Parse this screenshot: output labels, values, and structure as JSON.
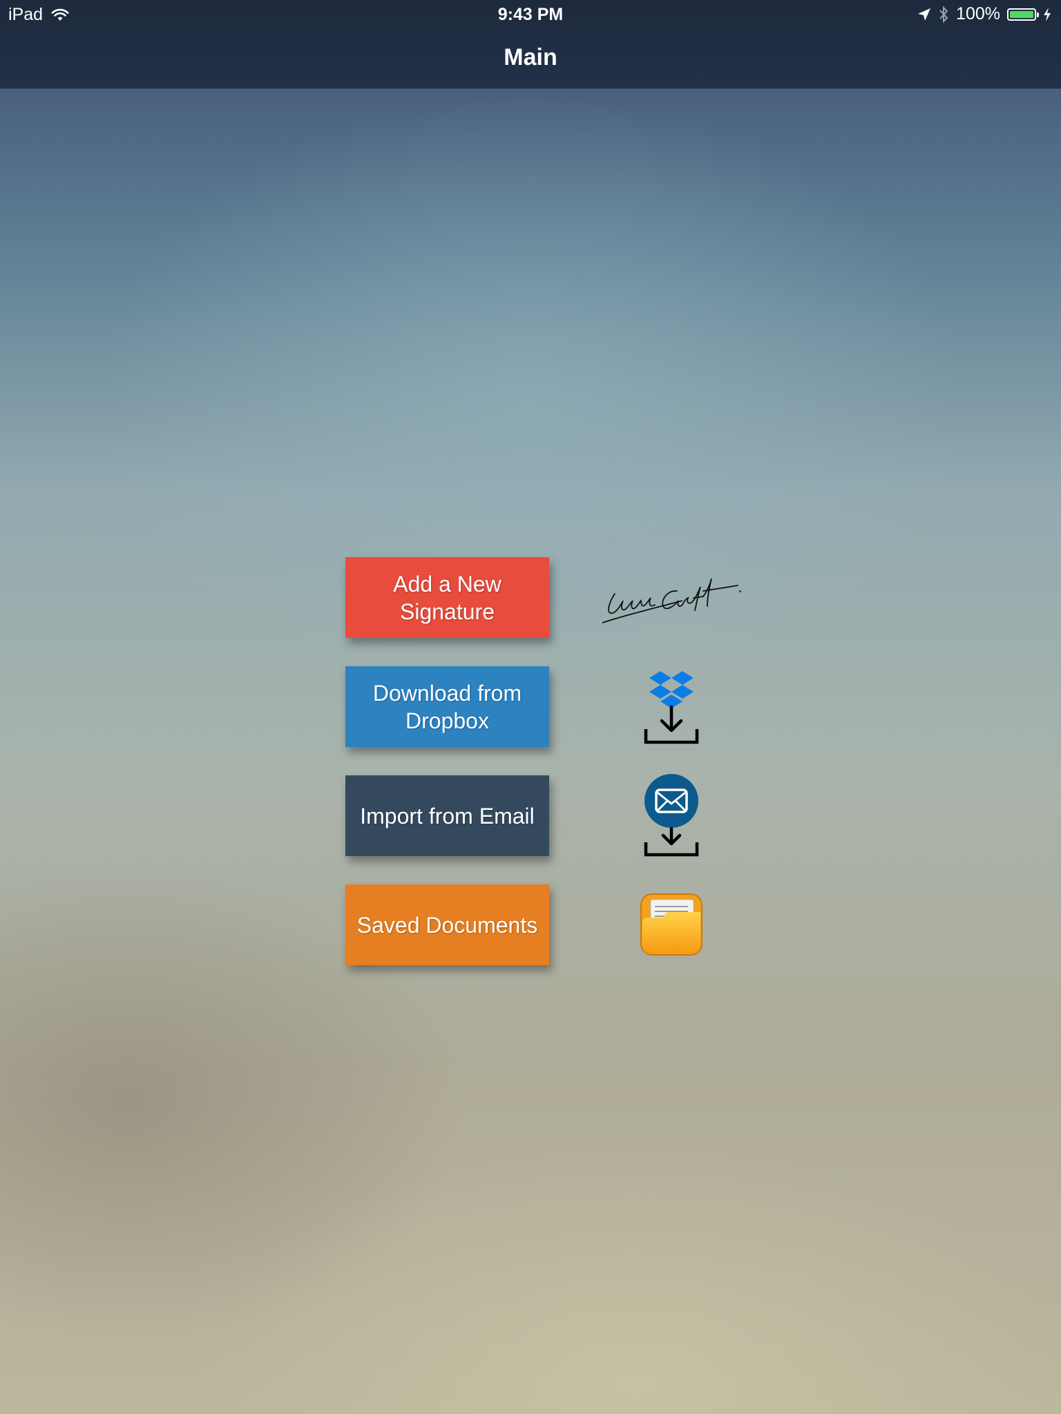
{
  "status_bar": {
    "device": "iPad",
    "time": "9:43 PM",
    "battery_percent": "100%",
    "battery_level": 1.0,
    "icons": [
      "wifi-icon",
      "location-arrow-icon",
      "bluetooth-icon",
      "battery-icon",
      "charging-bolt-icon"
    ]
  },
  "nav": {
    "title": "Main"
  },
  "menu": [
    {
      "label": "Add a New Signature",
      "color": "#e74c3c",
      "icon": "signature-icon"
    },
    {
      "label": "Download from Dropbox",
      "color": "#2d82c0",
      "icon": "dropbox-download-icon"
    },
    {
      "label": "Import from Email",
      "color": "#34495e",
      "icon": "email-import-icon"
    },
    {
      "label": "Saved Documents",
      "color": "#e67e22",
      "icon": "folder-icon"
    }
  ],
  "colors": {
    "nav_bar": "#1e2a3c",
    "battery_fill": "#4cd964",
    "dropbox_blue": "#0d7de5",
    "email_circle": "#0d5a8c",
    "folder_orange": "#f5a623"
  }
}
